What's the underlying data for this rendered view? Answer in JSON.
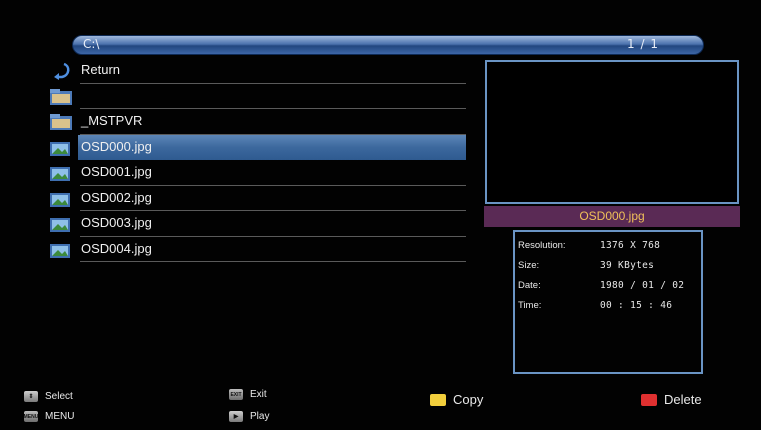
{
  "path_bar": {
    "path": "C:\\",
    "page": "1 / 1"
  },
  "files": [
    {
      "label": "Return",
      "icon": "return-arrow-icon",
      "selected": false
    },
    {
      "label": "",
      "icon": "folder-icon",
      "selected": false
    },
    {
      "label": "_MSTPVR",
      "icon": "folder-icon",
      "selected": false
    },
    {
      "label": "OSD000.jpg",
      "icon": "image-file-icon",
      "selected": true
    },
    {
      "label": "OSD001.jpg",
      "icon": "image-file-icon",
      "selected": false
    },
    {
      "label": "OSD002.jpg",
      "icon": "image-file-icon",
      "selected": false
    },
    {
      "label": "OSD003.jpg",
      "icon": "image-file-icon",
      "selected": false
    },
    {
      "label": "OSD004.jpg",
      "icon": "image-file-icon",
      "selected": false
    }
  ],
  "preview": {
    "filename": "OSD000.jpg",
    "info": [
      {
        "key": "Resolution:",
        "value": "1376 X 768"
      },
      {
        "key": "Size:",
        "value": "39 KBytes"
      },
      {
        "key": "Date:",
        "value": "1980 / 01 / 02"
      },
      {
        "key": "Time:",
        "value": "00 : 15 : 46"
      }
    ]
  },
  "footer": {
    "select": "Select",
    "menu": "MENU",
    "menu_key": "MENU",
    "exit": "Exit",
    "exit_key": "EXIT",
    "play": "Play",
    "copy": "Copy",
    "delete": "Delete"
  },
  "colors": {
    "highlight": "#3c689d",
    "accent_border": "#6a94c4",
    "filename_bg": "#5a2a55",
    "filename_text": "#f0c05a",
    "copy_key": "#f2cf3c",
    "delete_key": "#e03030"
  }
}
